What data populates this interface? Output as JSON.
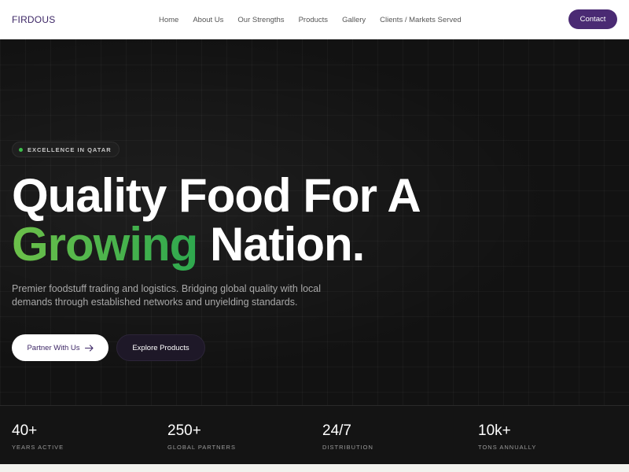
{
  "nav": {
    "logo": "FIRDOUS",
    "links": [
      "Home",
      "About Us",
      "Our Strengths",
      "Products",
      "Gallery",
      "Clients / Markets Served"
    ],
    "contact_label": "Contact"
  },
  "hero": {
    "badge": "EXCELLENCE IN QATAR",
    "headline_line1": "Quality Food For A",
    "headline_accent": "Growing",
    "headline_rest": "Nation.",
    "subtitle": "Premier foodstuff trading and logistics. Bridging global quality with local demands through established networks and unyielding standards.",
    "primary_button": "Partner With Us",
    "secondary_button": "Explore Products"
  },
  "stats": [
    {
      "value": "40+",
      "label": "YEARS ACTIVE"
    },
    {
      "value": "250+",
      "label": "GLOBAL PARTNERS"
    },
    {
      "value": "24/7",
      "label": "DISTRIBUTION"
    },
    {
      "value": "10k+",
      "label": "TONS ANNUALLY"
    }
  ],
  "colors": {
    "brand_purple": "#4a2a73",
    "accent_green": "#3cbf4a",
    "background": "#121212"
  },
  "icons": {
    "badge_dot": "status-dot-icon",
    "primary_arrow": "arrow-right-icon"
  }
}
